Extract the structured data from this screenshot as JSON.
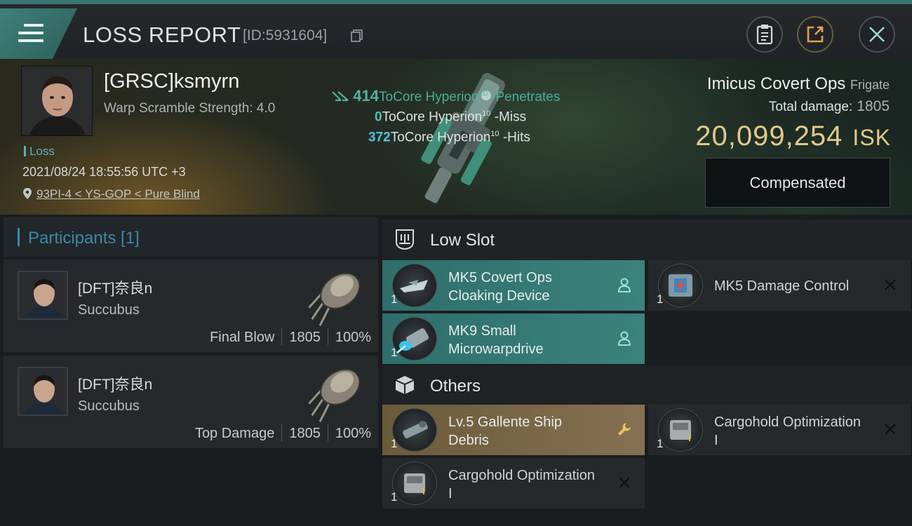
{
  "header": {
    "title": "LOSS REPORT",
    "report_id": "[ID:5931604]"
  },
  "victim": {
    "name": "[GRSC]ksmyrn",
    "scramble": "Warp Scramble Strength: 4.0",
    "loss_label": "Loss",
    "timestamp": "2021/08/24 18:55:56 UTC +3",
    "location": "93PI-4 < YS-GOP < Pure Blind",
    "ship_name": "Imicus Covert Ops",
    "ship_class": "Frigate",
    "total_damage_label": "Total damage:",
    "total_damage": "1805",
    "isk_value": "20,099,254",
    "isk_unit": "ISK",
    "compensated_label": "Compensated"
  },
  "damage_log": [
    {
      "value": "414",
      "target": "ToCore Hyperion",
      "level": "10",
      "result": "-Penetrates"
    },
    {
      "value": "0",
      "target": "ToCore Hyperion",
      "level": "10",
      "result": "-Miss"
    },
    {
      "value": "372",
      "target": "ToCore Hyperion",
      "level": "10",
      "result": "-Hits"
    }
  ],
  "participants": {
    "header": "Participants [1]",
    "rows": [
      {
        "name": "[DFT]奈良n",
        "ship": "Succubus",
        "role": "Final Blow",
        "damage": "1805",
        "percent": "100%"
      },
      {
        "name": "[DFT]奈良n",
        "ship": "Succubus",
        "role": "Top Damage",
        "damage": "1805",
        "percent": "100%"
      }
    ]
  },
  "sections": {
    "low_slot": "Low Slot",
    "others": "Others"
  },
  "modules": {
    "low": [
      {
        "qty": "1",
        "name": "MK5 Covert Ops Cloaking Device",
        "style": "teal",
        "action": "person-icon"
      },
      {
        "qty": "1",
        "name": "MK5 Damage Control",
        "style": "dark",
        "action": "close-icon"
      },
      {
        "qty": "1",
        "name": "MK9 Small Microwarpdrive",
        "style": "teal",
        "action": "person-icon"
      }
    ],
    "others": [
      {
        "qty": "1",
        "name": "Lv.5 Gallente Ship Debris",
        "style": "gold",
        "action": "wrench-icon"
      },
      {
        "qty": "1",
        "name": "Cargohold Optimization I",
        "style": "dark",
        "action": "close-icon"
      },
      {
        "qty": "1",
        "name": "Cargohold Optimization I",
        "style": "dark",
        "action": "close-icon"
      }
    ]
  },
  "colors": {
    "accent_teal": "#3a827c",
    "isk_gold": "#e3c989",
    "participants_blue": "#3b8aa8",
    "salvage_gold": "#857151"
  }
}
